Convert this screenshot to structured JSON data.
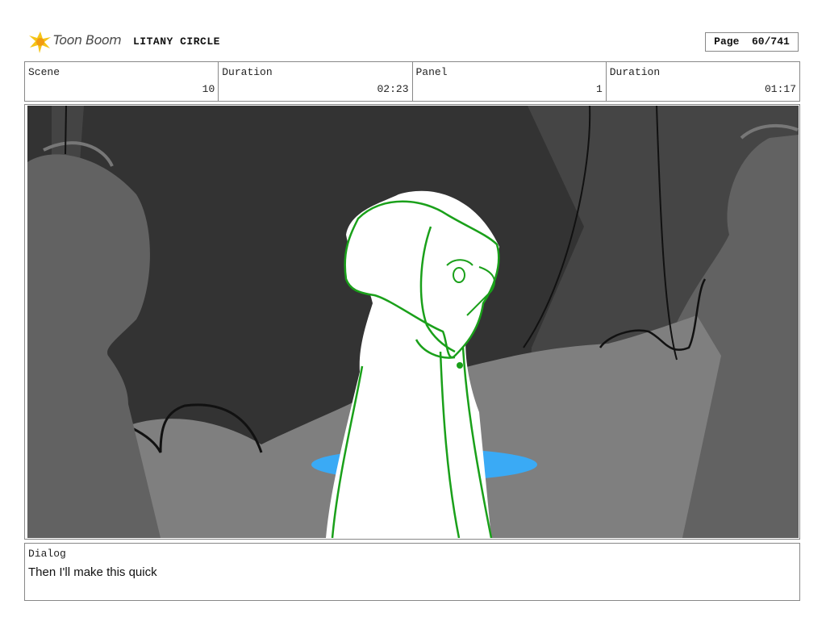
{
  "header": {
    "logo_text": "Toon Boom",
    "project_title": "LITANY CIRCLE",
    "page_label": "Page",
    "page_value": "60/741"
  },
  "info": {
    "scene_label": "Scene",
    "scene_value": "10",
    "scene_duration_label": "Duration",
    "scene_duration_value": "02:23",
    "panel_label": "Panel",
    "panel_value": "1",
    "panel_duration_label": "Duration",
    "panel_duration_value": "01:17"
  },
  "panel": {
    "icons": [
      "toon-boom-logo-icon"
    ],
    "colors": {
      "background": "#333333",
      "rock": "#7f7f7f",
      "pillar": "#646464",
      "puddle": "#3aaaf5",
      "character_line": "#1aa01a"
    }
  },
  "dialog": {
    "label": "Dialog",
    "text": "Then I'll make this quick"
  }
}
